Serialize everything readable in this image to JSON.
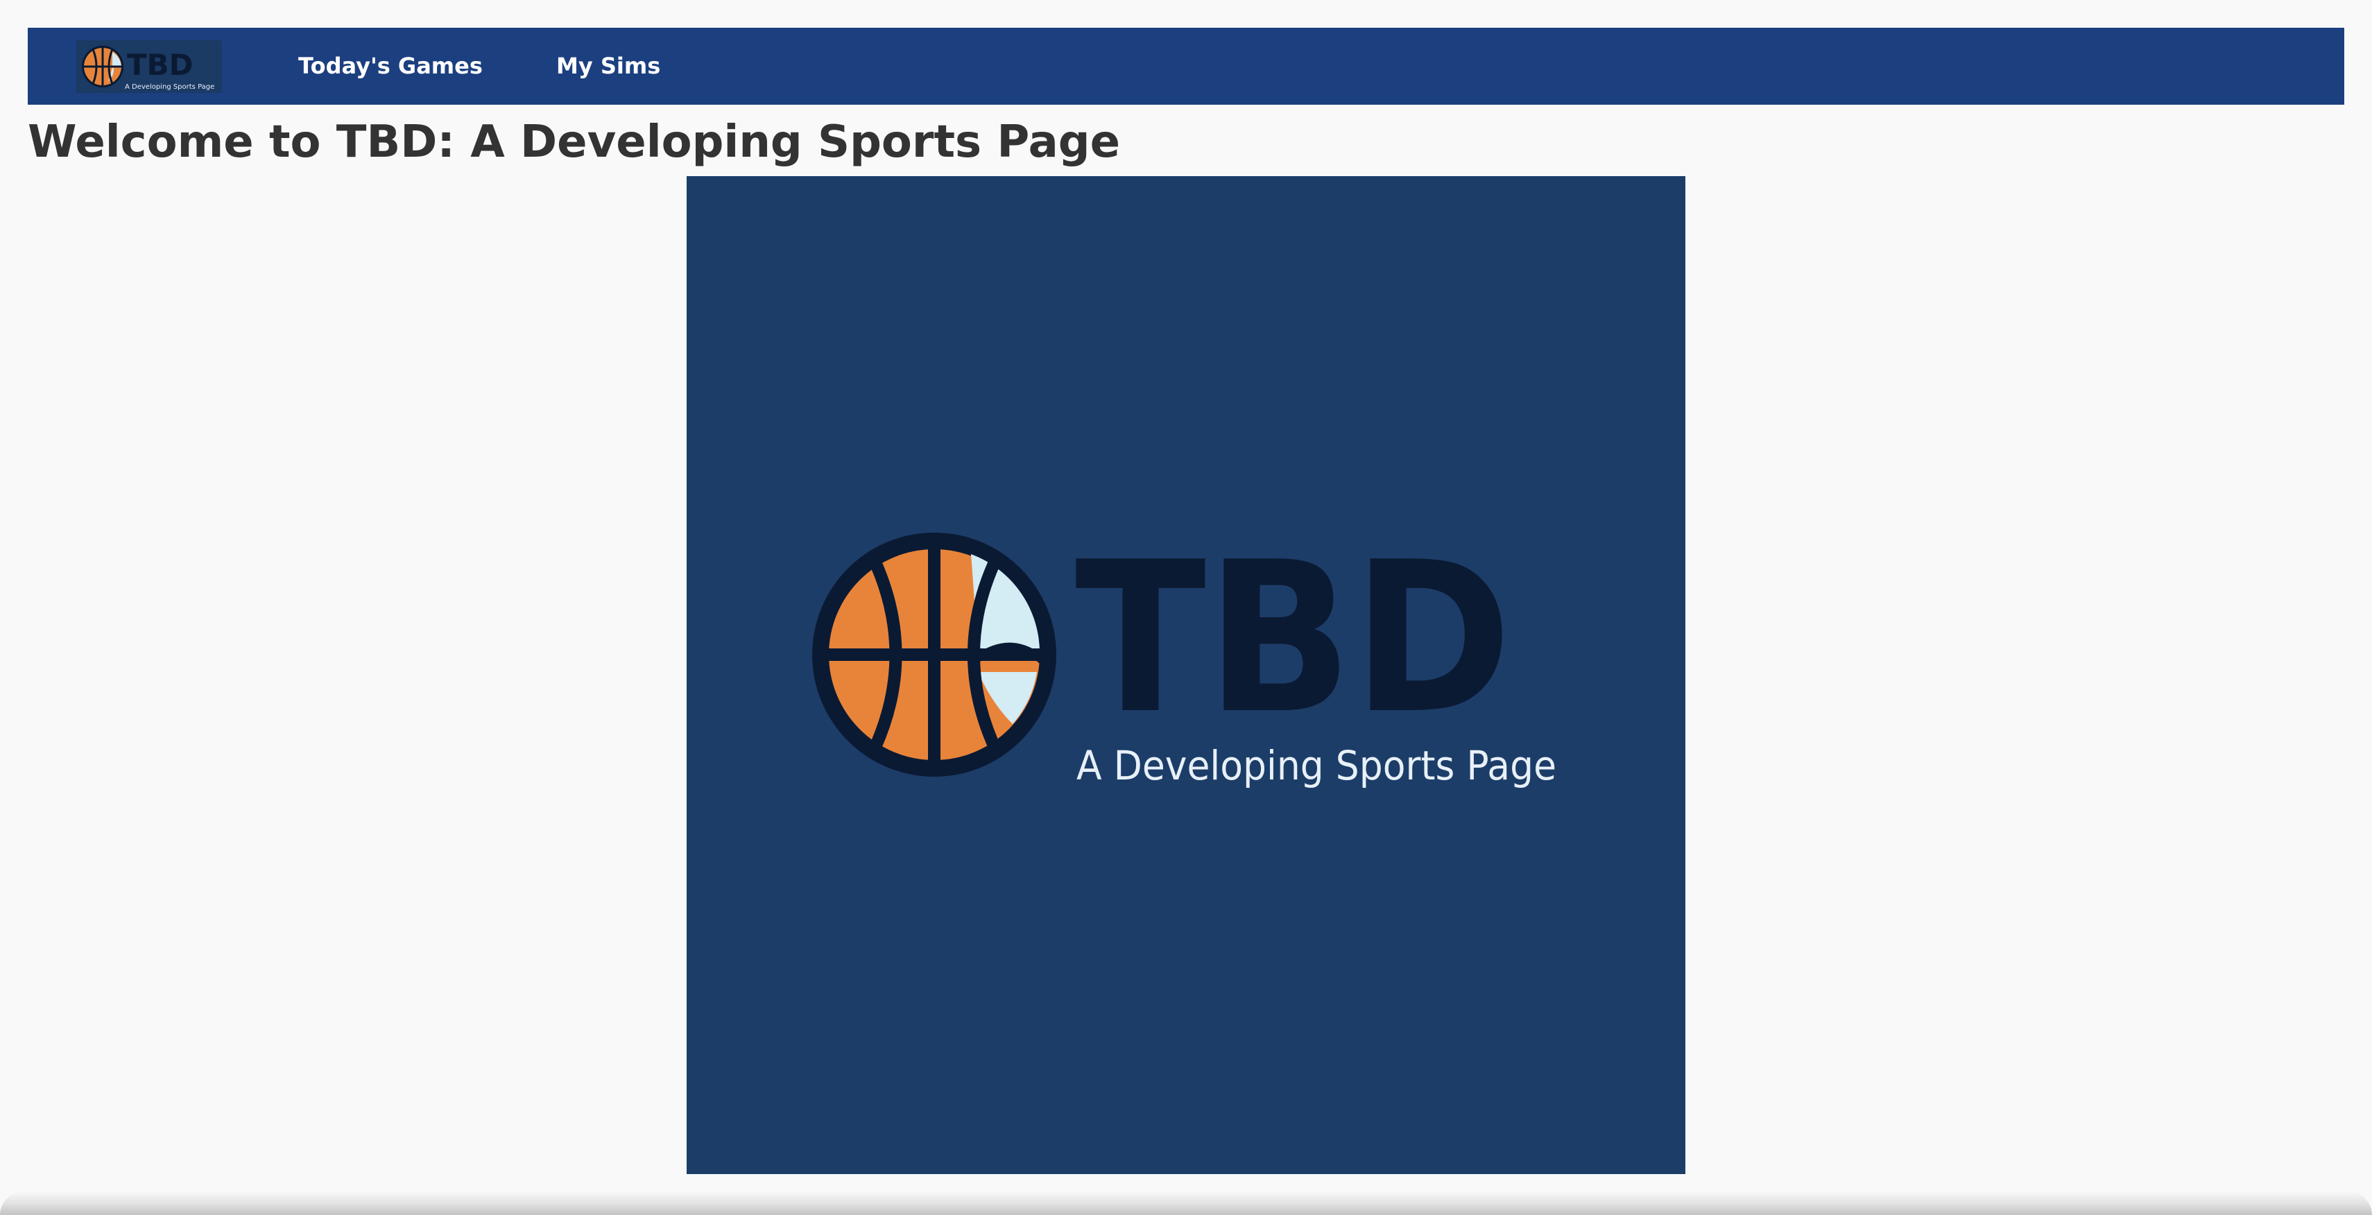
{
  "nav": {
    "logo": {
      "wordmark": "TBD",
      "tagline": "A Developing Sports Page"
    },
    "links": [
      {
        "label": "Today's Games"
      },
      {
        "label": "My Sims"
      }
    ]
  },
  "main": {
    "title": "Welcome to TBD: A Developing Sports Page",
    "hero": {
      "wordmark": "TBD",
      "tagline": "A Developing Sports Page"
    }
  },
  "colors": {
    "navbar": "#1c3f80",
    "hero_background": "#1c3d68",
    "ball_orange": "#e8843a",
    "ball_light": "#d4ecf4",
    "ink": "#0b1a33",
    "tagline": "#e8f0f8",
    "page_background": "#f9f9f9"
  }
}
